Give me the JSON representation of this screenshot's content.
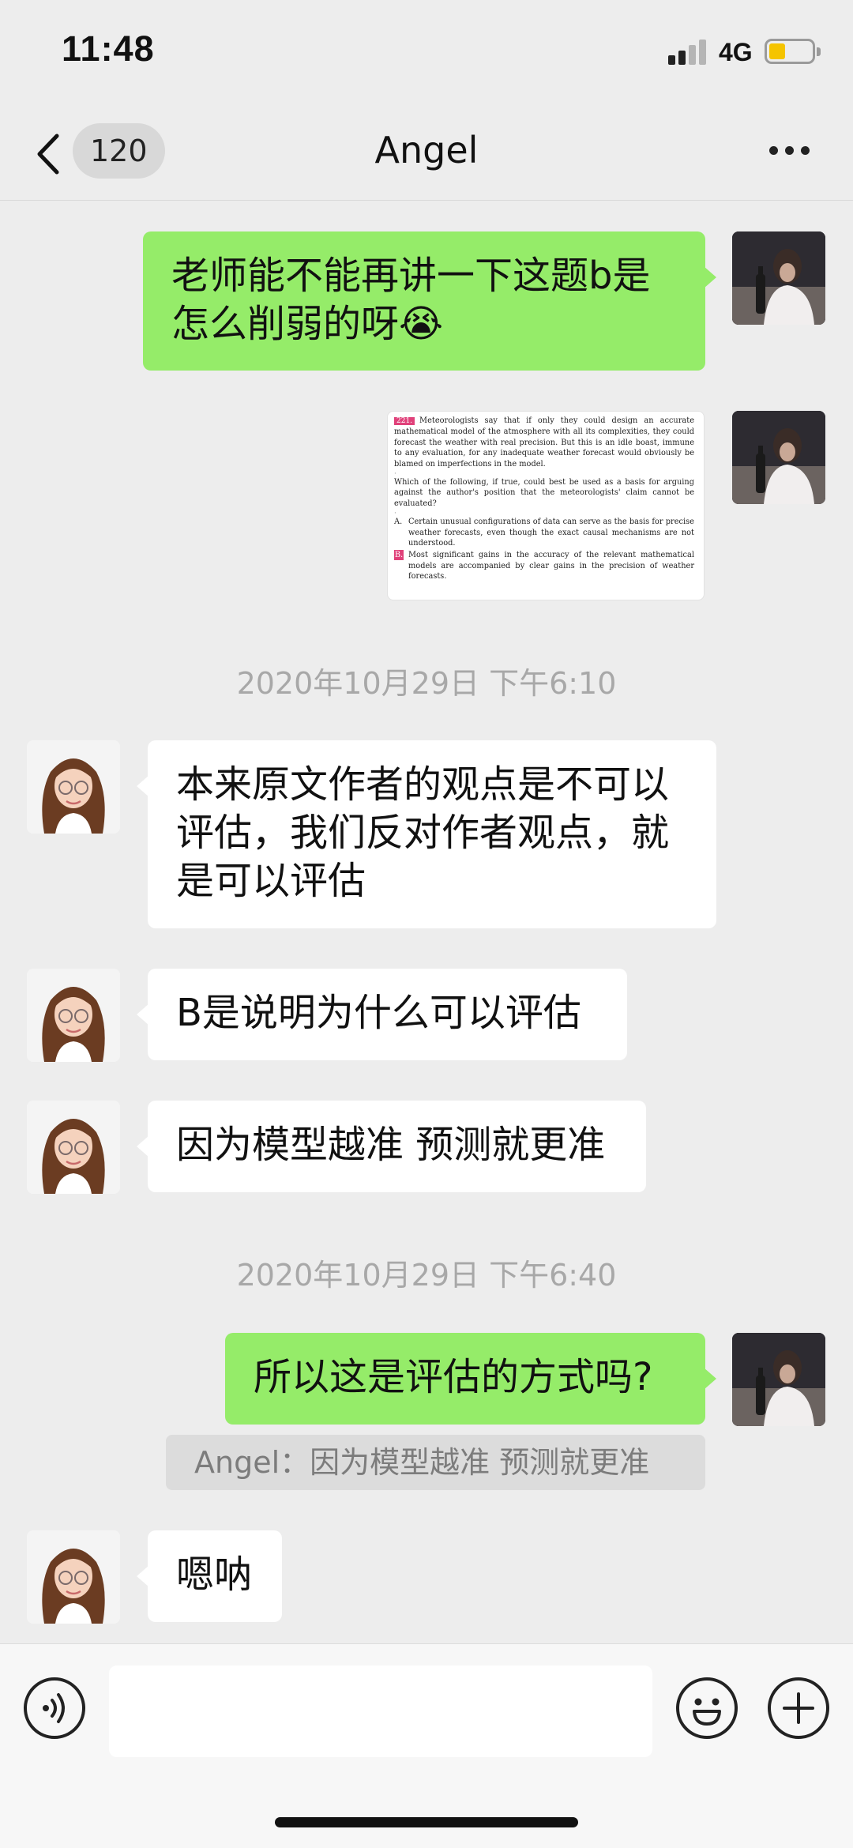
{
  "status_bar": {
    "time": "11:48",
    "network": "4G"
  },
  "header": {
    "unread_count": "120",
    "title": "Angel"
  },
  "messages": [
    {
      "text": "老师能不能再讲一下这题b是怎么削弱的呀😭"
    },
    {
      "text": "本来原文作者的观点是不可以评估，我们反对作者观点，就是可以评估"
    },
    {
      "text": "B是说明为什么可以评估"
    },
    {
      "text": "因为模型越准 预测就更准"
    },
    {
      "text": "所以这是评估的方式吗?"
    },
    {
      "text": "嗯呐"
    }
  ],
  "timestamps": [
    "2020年10月29日 下午6:10",
    "2020年10月29日 下午6:40"
  ],
  "quote": "Angel：因为模型越准 预测就更准",
  "image_message": {
    "number": "221.",
    "passage": "Meteorologists say that if only they could design an accurate mathematical model of the atmosphere with all its complexities, they could forecast the weather with real precision. But this is an idle boast, immune to any evaluation, for any inadequate weather forecast would obviously be blamed on imperfections in the model.",
    "question": "Which of the following, if true, could best be used as a basis for arguing against the author's position that the meteorologists' claim cannot be evaluated?",
    "options": [
      {
        "letter": "A.",
        "text": "Certain unusual configurations of data can serve as the basis for precise weather forecasts, even though the exact causal mechanisms are not understood."
      },
      {
        "letter": "B.",
        "text": "Most significant gains in the accuracy of the relevant mathematical models are accompanied by clear gains in the precision of weather forecasts."
      }
    ]
  },
  "icons": {
    "back": "chevron-left-icon",
    "more": "more-icon",
    "voice": "voice-icon",
    "emoji": "emoji-icon",
    "add": "plus-icon"
  },
  "colors": {
    "my_bubble": "#95ec69",
    "their_bubble": "#ffffff",
    "background": "#ededed",
    "battery": "#f5c400"
  }
}
